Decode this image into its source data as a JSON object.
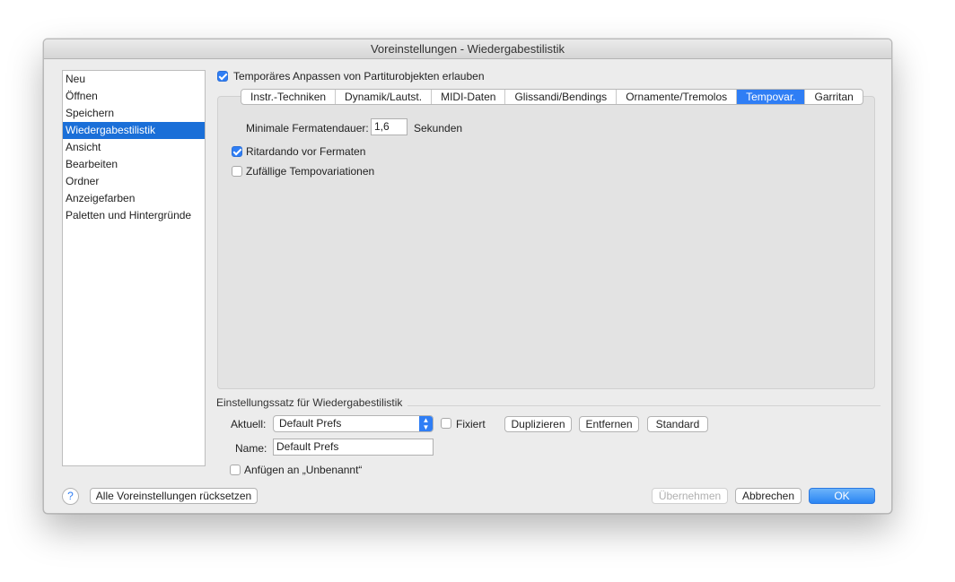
{
  "window": {
    "title": "Voreinstellungen - Wiedergabestilistik"
  },
  "sidebar": {
    "items": [
      {
        "label": "Neu"
      },
      {
        "label": "Öffnen"
      },
      {
        "label": "Speichern"
      },
      {
        "label": "Wiedergabestilistik",
        "selected": true
      },
      {
        "label": "Ansicht"
      },
      {
        "label": "Bearbeiten"
      },
      {
        "label": "Ordner"
      },
      {
        "label": "Anzeigefarben"
      },
      {
        "label": "Paletten und Hintergründe"
      }
    ]
  },
  "main": {
    "temp_adjust": {
      "label": "Temporäres Anpassen von Partiturobjekten erlauben",
      "checked": true
    },
    "tabs": [
      {
        "label": "Instr.-Techniken"
      },
      {
        "label": "Dynamik/Lautst."
      },
      {
        "label": "MIDI-Daten"
      },
      {
        "label": "Glissandi/Bendings"
      },
      {
        "label": "Ornamente/Tremolos"
      },
      {
        "label": "Tempovar.",
        "active": true
      },
      {
        "label": "Garritan"
      }
    ],
    "fermata": {
      "label": "Minimale Fermatendauer:",
      "value": "1,6",
      "unit": "Sekunden"
    },
    "ritardando": {
      "label": "Ritardando vor Fermaten",
      "checked": true
    },
    "random_tempo": {
      "label": "Zufällige Tempovariationen",
      "checked": false
    }
  },
  "preset": {
    "section_title": "Einstellungssatz für Wiedergabestilistik",
    "current_label": "Aktuell:",
    "current_value": "Default Prefs",
    "fixed": {
      "label": "Fixiert",
      "checked": false
    },
    "duplicate": "Duplizieren",
    "remove": "Entfernen",
    "standard": "Standard",
    "name_label": "Name:",
    "name_value": "Default Prefs",
    "append": {
      "label": "Anfügen an „Unbenannt“",
      "checked": false
    }
  },
  "footer": {
    "help": "?",
    "reset_all": "Alle Voreinstellungen rücksetzen",
    "apply": "Übernehmen",
    "cancel": "Abbrechen",
    "ok": "OK"
  },
  "colors": {
    "accent": "#2f7ef5",
    "selection": "#1a6fd8"
  }
}
